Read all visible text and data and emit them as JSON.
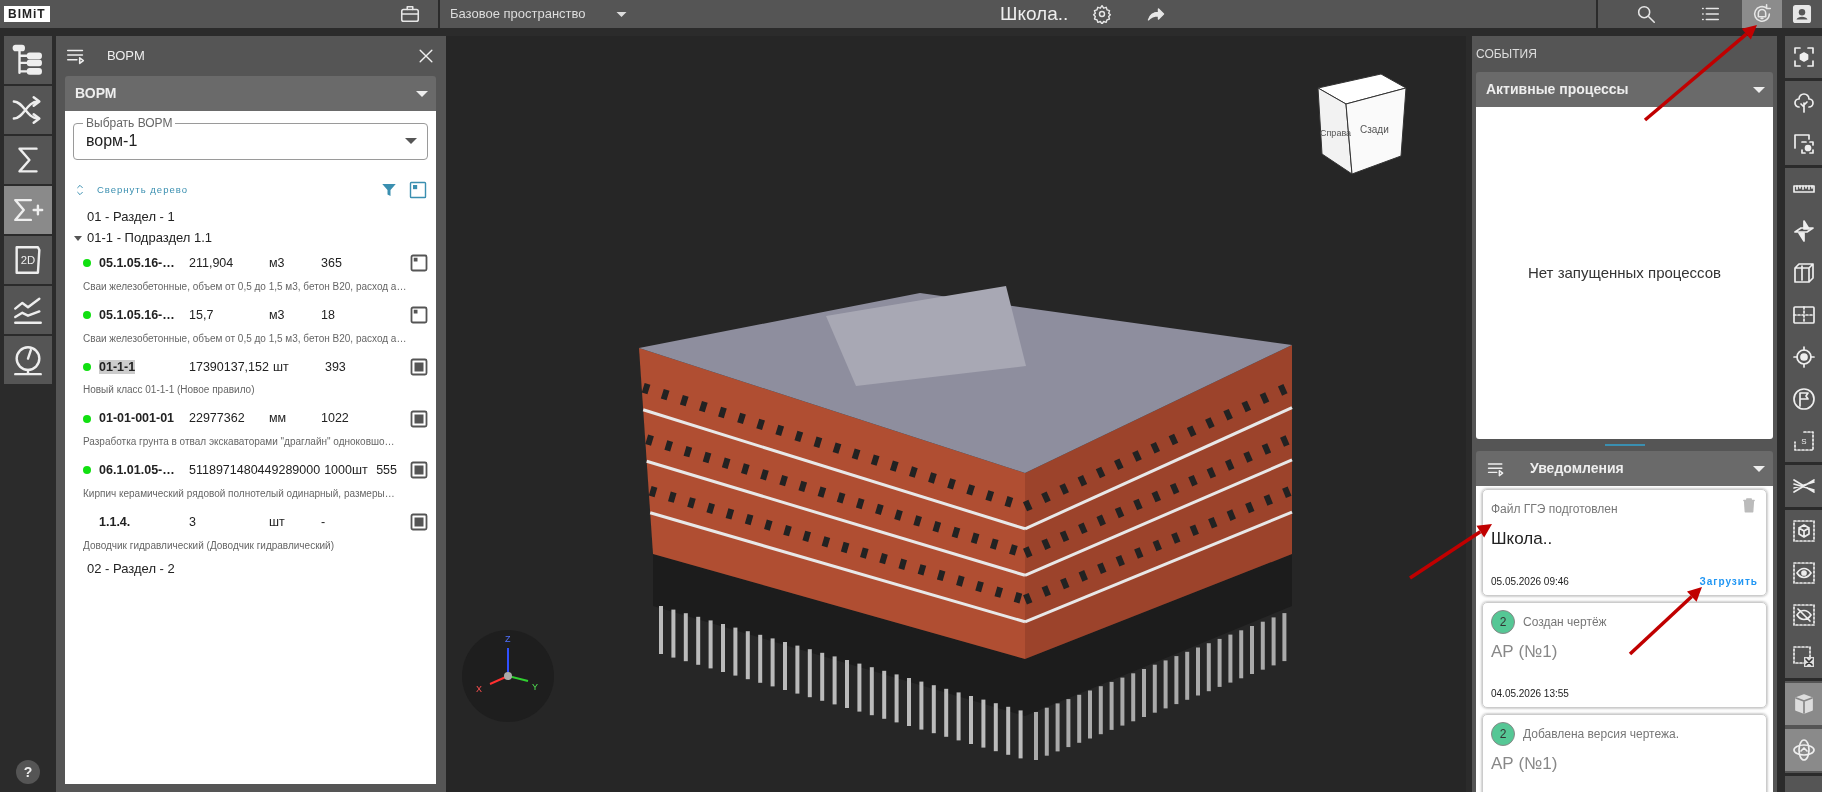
{
  "topbar": {
    "logo": "BIMiT",
    "workspace": "Базовое пространство",
    "project_title": "Школа..",
    "actions": [
      {
        "kind": "search",
        "selected": false
      },
      {
        "kind": "list",
        "selected": false
      },
      {
        "kind": "notifications",
        "selected": true
      },
      {
        "kind": "user",
        "selected": false
      }
    ]
  },
  "left_toolbar": [
    {
      "kind": "tree",
      "selected": false
    },
    {
      "kind": "shuffle",
      "selected": false
    },
    {
      "kind": "sigma",
      "selected": false
    },
    {
      "kind": "sigma-plus",
      "selected": true
    },
    {
      "kind": "sheet",
      "label": "2D",
      "selected": false
    },
    {
      "kind": "chart",
      "selected": false
    },
    {
      "kind": "gauge",
      "selected": false
    }
  ],
  "help_button": "?",
  "vorm_panel": {
    "title": "ВОРМ",
    "section_title": "ВОРМ",
    "select_label": "Выбрать ВОРМ",
    "select_value": "ворм-1",
    "collapse_link": "Свернуть дерево",
    "tree": [
      {
        "kind": "group",
        "label": "01 - Раздел - 1"
      },
      {
        "kind": "group",
        "label": "01-1 - Подраздел 1.1",
        "expanded": true,
        "children": [
          {
            "kind": "item",
            "code": "05.1.05.16-…",
            "quantity": "211,904",
            "unit": "м3",
            "count": "365",
            "description": "Сваи железобетонные, объем от 0,5 до 1,5 м3, бетон В20, расход а…",
            "status": true,
            "highlighted": false,
            "checked": false
          },
          {
            "kind": "item",
            "code": "05.1.05.16-…",
            "quantity": "15,7",
            "unit": "м3",
            "count": "18",
            "description": "Сваи железобетонные, объем от 0,5 до 1,5 м3, бетон В20, расход а…",
            "status": true,
            "highlighted": false,
            "checked": false
          },
          {
            "kind": "item",
            "code": "01-1-1",
            "quantity": "17390137,152",
            "unit": "шт",
            "count": "393",
            "description": "Новый класс 01-1-1 (Новое правило)",
            "status": true,
            "highlighted": true,
            "checked": true
          },
          {
            "kind": "item",
            "code": "01-01-001-01",
            "quantity": "22977362",
            "unit": "мм",
            "count": "1022",
            "description": "Разработка грунта в отвал экскаваторами \"драглайн\" одноковшо…",
            "status": true,
            "highlighted": false,
            "checked": true
          },
          {
            "kind": "item",
            "code": "06.1.01.05-…",
            "quantity": "5118971480449289000",
            "unit": "1000шт",
            "count": "555",
            "description": "Кирпич керамический рядовой полнотелый одинарный, размеры…",
            "status": true,
            "highlighted": false,
            "checked": true
          },
          {
            "kind": "item",
            "code": "1.1.4.",
            "quantity": "3",
            "unit": "шт",
            "count": "-",
            "description": "Доводчик гидравлический (Доводчик гидравлический)",
            "status": false,
            "highlighted": false,
            "checked": true
          }
        ]
      },
      {
        "kind": "group",
        "label": "02 - Раздел - 2"
      }
    ]
  },
  "viewport": {
    "view_cube": [
      "Справа",
      "Сзади"
    ],
    "axes": [
      "Z",
      "X",
      "Y"
    ]
  },
  "events_panel": {
    "title": "СОБЫТИЯ",
    "processes": {
      "title": "Активные процессы",
      "empty_text": "Нет запущенных процессов"
    },
    "notifications": {
      "title": "Уведомления",
      "items": [
        {
          "kind": "file",
          "title": "Файл ГГЭ подготовлен",
          "subject": "Школа..",
          "time": "05.05.2026 09:46",
          "action": "Загрузить"
        },
        {
          "kind": "drawing",
          "badge": "2",
          "title": "Создан чертёж",
          "subject": "АР (№1)",
          "time": "04.05.2026 13:55"
        },
        {
          "kind": "drawing",
          "badge": "2",
          "title": "Добавлена версия чертежа.",
          "subject": "АР (№1)"
        }
      ]
    }
  },
  "right_toolbar": [
    [
      {
        "kind": "focus",
        "selected": false
      }
    ],
    [
      {
        "kind": "tree-cloud",
        "selected": false
      },
      {
        "kind": "screen-focus",
        "selected": false
      }
    ],
    [
      {
        "kind": "ruler",
        "selected": false
      },
      {
        "kind": "section-plane",
        "selected": false
      },
      {
        "kind": "section-box",
        "selected": false
      },
      {
        "kind": "floor-plan",
        "selected": false
      },
      {
        "kind": "target",
        "selected": false
      },
      {
        "kind": "flag",
        "selected": false
      },
      {
        "kind": "selection-frame",
        "label": "S",
        "selected": false
      }
    ],
    [
      {
        "kind": "grid-axes",
        "selected": false
      }
    ],
    [
      {
        "kind": "dashed-cube",
        "selected": false
      },
      {
        "kind": "dashed-eye",
        "selected": false
      },
      {
        "kind": "dashed-eye-off",
        "selected": false
      },
      {
        "kind": "dashed-close",
        "selected": false
      }
    ],
    [
      {
        "kind": "cube",
        "selected": true
      },
      {
        "kind": "orbit",
        "selected": true
      }
    ]
  ]
}
